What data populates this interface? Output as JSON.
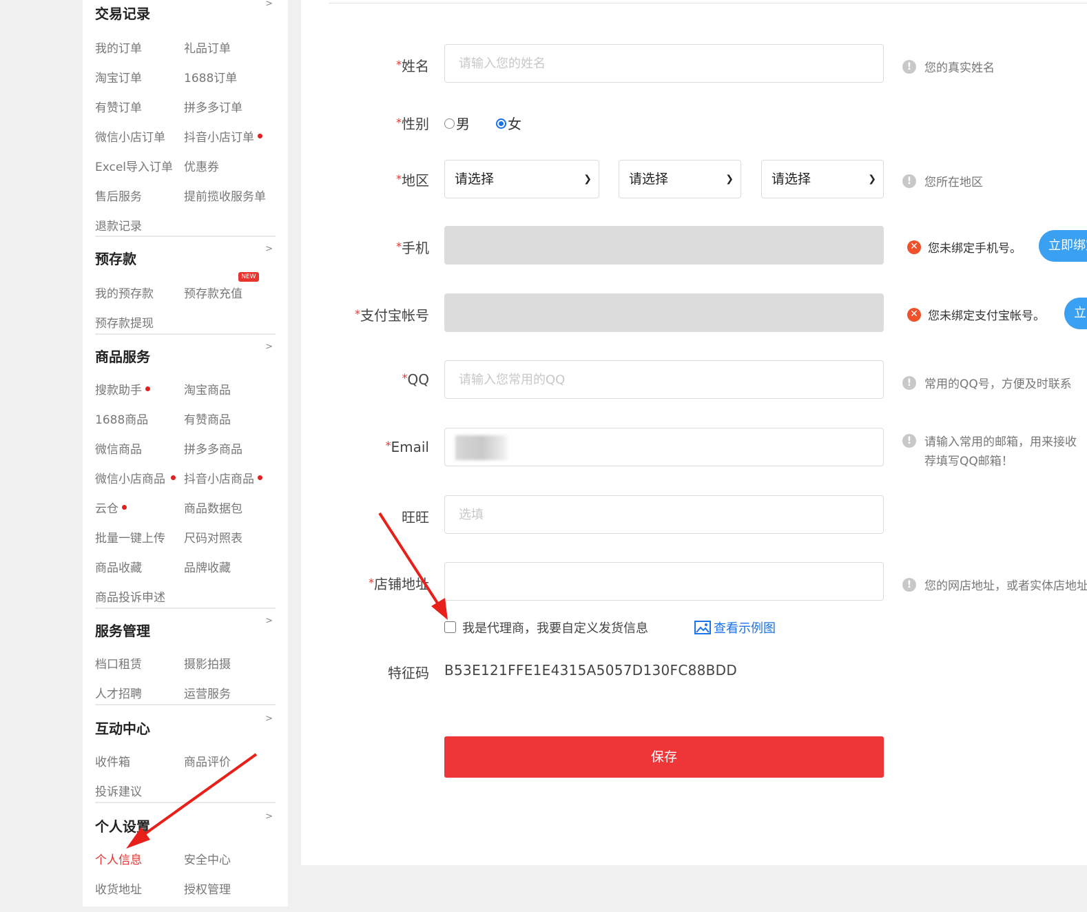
{
  "sidebar": {
    "sections": [
      {
        "title": "交易记录",
        "items": [
          "我的订单",
          "礼品订单",
          "淘宝订单",
          "1688订单",
          "有赞订单",
          "拼多多订单",
          "微信小店订单",
          "抖音小店订单",
          "Excel导入订单",
          "优惠券",
          "售后服务",
          "提前揽收服务单",
          "退款记录"
        ]
      },
      {
        "title": "预存款",
        "items": [
          "我的预存款",
          "预存款充值",
          "预存款提现"
        ],
        "badge": "NEW"
      },
      {
        "title": "商品服务",
        "items": [
          "搜款助手",
          "淘宝商品",
          "1688商品",
          "有赞商品",
          "微信商品",
          "拼多多商品",
          "微信小店商品",
          "抖音小店商品",
          "云仓",
          "商品数据包",
          "批量一键上传",
          "尺码对照表",
          "商品收藏",
          "品牌收藏",
          "商品投诉申述"
        ]
      },
      {
        "title": "服务管理",
        "items": [
          "档口租赁",
          "摄影拍摄",
          "人才招聘",
          "运营服务"
        ]
      },
      {
        "title": "互动中心",
        "items": [
          "收件箱",
          "商品评价",
          "投诉建议"
        ]
      },
      {
        "title": "个人设置",
        "items": [
          "个人信息",
          "安全中心",
          "收货地址",
          "授权管理"
        ],
        "active": "个人信息"
      }
    ],
    "arrow": ">"
  },
  "form": {
    "required_mark": "*",
    "name": {
      "label": "姓名",
      "placeholder": "请输入您的姓名",
      "hint": "您的真实姓名"
    },
    "gender": {
      "label": "性别",
      "options": [
        "男",
        "女"
      ],
      "selected": "女"
    },
    "region": {
      "label": "地区",
      "select1": "请选择",
      "select2": "请选择",
      "select3": "请选择",
      "hint": "您所在地区"
    },
    "phone": {
      "label": "手机",
      "error": "您未绑定手机号。",
      "button": "立即绑定"
    },
    "alipay": {
      "label": "支付宝帐号",
      "error": "您未绑定支付宝帐号。",
      "button": "立即绑定"
    },
    "qq": {
      "label": "QQ",
      "placeholder": "请输入您常用的QQ",
      "hint": "常用的QQ号，方便及时联系"
    },
    "email": {
      "label": "Email",
      "hint_line1": "请输入常用的邮箱，用来接收",
      "hint_line2": "荐填写QQ邮箱！"
    },
    "wangwang": {
      "label": "旺旺",
      "placeholder": "选填"
    },
    "shop": {
      "label": "店铺地址",
      "hint": "您的网店地址，或者实体店地址"
    },
    "agent": {
      "checkbox_label": "我是代理商，我要自定义发货信息",
      "example_link": "查看示例图",
      "checked": false
    },
    "feature_code": {
      "label": "特征码",
      "value": "B53E121FFE1E4315A5057D130FC88BDD"
    },
    "save_button": "保存"
  },
  "colors": {
    "accent_red": "#ee3638",
    "active_red": "#e8332f",
    "link_blue": "#1a73e8",
    "bind_blue": "#3aa0f2",
    "error_orange": "#f0512a"
  }
}
